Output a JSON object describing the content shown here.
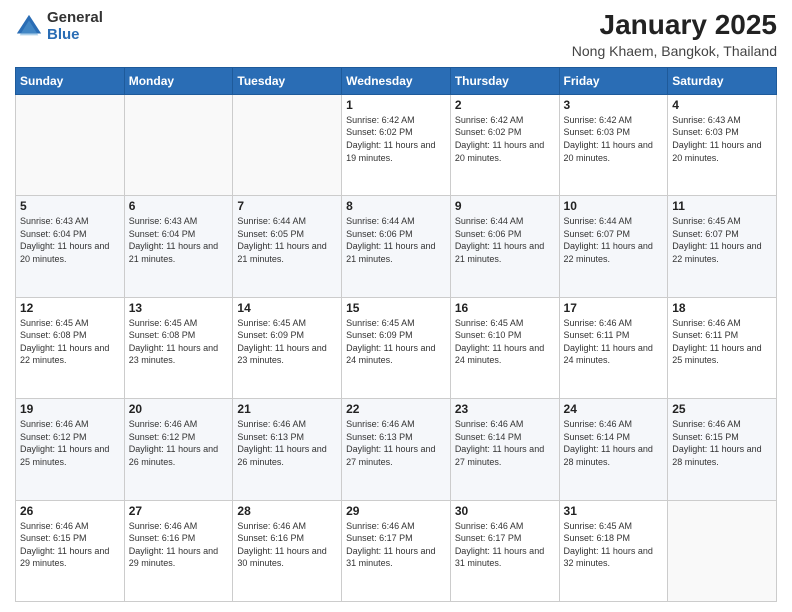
{
  "header": {
    "logo_general": "General",
    "logo_blue": "Blue",
    "month_title": "January 2025",
    "location": "Nong Khaem, Bangkok, Thailand"
  },
  "days_of_week": [
    "Sunday",
    "Monday",
    "Tuesday",
    "Wednesday",
    "Thursday",
    "Friday",
    "Saturday"
  ],
  "weeks": [
    [
      {
        "day": "",
        "info": ""
      },
      {
        "day": "",
        "info": ""
      },
      {
        "day": "",
        "info": ""
      },
      {
        "day": "1",
        "info": "Sunrise: 6:42 AM\nSunset: 6:02 PM\nDaylight: 11 hours and 19 minutes."
      },
      {
        "day": "2",
        "info": "Sunrise: 6:42 AM\nSunset: 6:02 PM\nDaylight: 11 hours and 20 minutes."
      },
      {
        "day": "3",
        "info": "Sunrise: 6:42 AM\nSunset: 6:03 PM\nDaylight: 11 hours and 20 minutes."
      },
      {
        "day": "4",
        "info": "Sunrise: 6:43 AM\nSunset: 6:03 PM\nDaylight: 11 hours and 20 minutes."
      }
    ],
    [
      {
        "day": "5",
        "info": "Sunrise: 6:43 AM\nSunset: 6:04 PM\nDaylight: 11 hours and 20 minutes."
      },
      {
        "day": "6",
        "info": "Sunrise: 6:43 AM\nSunset: 6:04 PM\nDaylight: 11 hours and 21 minutes."
      },
      {
        "day": "7",
        "info": "Sunrise: 6:44 AM\nSunset: 6:05 PM\nDaylight: 11 hours and 21 minutes."
      },
      {
        "day": "8",
        "info": "Sunrise: 6:44 AM\nSunset: 6:06 PM\nDaylight: 11 hours and 21 minutes."
      },
      {
        "day": "9",
        "info": "Sunrise: 6:44 AM\nSunset: 6:06 PM\nDaylight: 11 hours and 21 minutes."
      },
      {
        "day": "10",
        "info": "Sunrise: 6:44 AM\nSunset: 6:07 PM\nDaylight: 11 hours and 22 minutes."
      },
      {
        "day": "11",
        "info": "Sunrise: 6:45 AM\nSunset: 6:07 PM\nDaylight: 11 hours and 22 minutes."
      }
    ],
    [
      {
        "day": "12",
        "info": "Sunrise: 6:45 AM\nSunset: 6:08 PM\nDaylight: 11 hours and 22 minutes."
      },
      {
        "day": "13",
        "info": "Sunrise: 6:45 AM\nSunset: 6:08 PM\nDaylight: 11 hours and 23 minutes."
      },
      {
        "day": "14",
        "info": "Sunrise: 6:45 AM\nSunset: 6:09 PM\nDaylight: 11 hours and 23 minutes."
      },
      {
        "day": "15",
        "info": "Sunrise: 6:45 AM\nSunset: 6:09 PM\nDaylight: 11 hours and 24 minutes."
      },
      {
        "day": "16",
        "info": "Sunrise: 6:45 AM\nSunset: 6:10 PM\nDaylight: 11 hours and 24 minutes."
      },
      {
        "day": "17",
        "info": "Sunrise: 6:46 AM\nSunset: 6:11 PM\nDaylight: 11 hours and 24 minutes."
      },
      {
        "day": "18",
        "info": "Sunrise: 6:46 AM\nSunset: 6:11 PM\nDaylight: 11 hours and 25 minutes."
      }
    ],
    [
      {
        "day": "19",
        "info": "Sunrise: 6:46 AM\nSunset: 6:12 PM\nDaylight: 11 hours and 25 minutes."
      },
      {
        "day": "20",
        "info": "Sunrise: 6:46 AM\nSunset: 6:12 PM\nDaylight: 11 hours and 26 minutes."
      },
      {
        "day": "21",
        "info": "Sunrise: 6:46 AM\nSunset: 6:13 PM\nDaylight: 11 hours and 26 minutes."
      },
      {
        "day": "22",
        "info": "Sunrise: 6:46 AM\nSunset: 6:13 PM\nDaylight: 11 hours and 27 minutes."
      },
      {
        "day": "23",
        "info": "Sunrise: 6:46 AM\nSunset: 6:14 PM\nDaylight: 11 hours and 27 minutes."
      },
      {
        "day": "24",
        "info": "Sunrise: 6:46 AM\nSunset: 6:14 PM\nDaylight: 11 hours and 28 minutes."
      },
      {
        "day": "25",
        "info": "Sunrise: 6:46 AM\nSunset: 6:15 PM\nDaylight: 11 hours and 28 minutes."
      }
    ],
    [
      {
        "day": "26",
        "info": "Sunrise: 6:46 AM\nSunset: 6:15 PM\nDaylight: 11 hours and 29 minutes."
      },
      {
        "day": "27",
        "info": "Sunrise: 6:46 AM\nSunset: 6:16 PM\nDaylight: 11 hours and 29 minutes."
      },
      {
        "day": "28",
        "info": "Sunrise: 6:46 AM\nSunset: 6:16 PM\nDaylight: 11 hours and 30 minutes."
      },
      {
        "day": "29",
        "info": "Sunrise: 6:46 AM\nSunset: 6:17 PM\nDaylight: 11 hours and 31 minutes."
      },
      {
        "day": "30",
        "info": "Sunrise: 6:46 AM\nSunset: 6:17 PM\nDaylight: 11 hours and 31 minutes."
      },
      {
        "day": "31",
        "info": "Sunrise: 6:45 AM\nSunset: 6:18 PM\nDaylight: 11 hours and 32 minutes."
      },
      {
        "day": "",
        "info": ""
      }
    ]
  ]
}
